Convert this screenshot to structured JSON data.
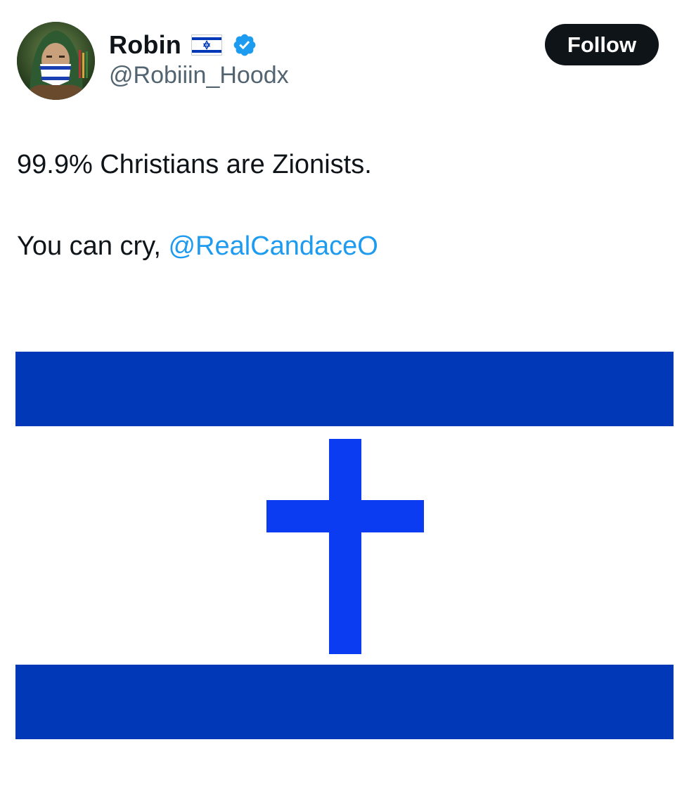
{
  "author": {
    "display_name": "Robin",
    "flag_emoji": "🇮🇱",
    "handle": "@Robiiin_Hoodx",
    "verified": true
  },
  "follow_button": {
    "label": "Follow"
  },
  "tweet": {
    "line1": "99.9% Christians are Zionists.",
    "line2_prefix": "You can cry, ",
    "mention": "@RealCandaceO"
  },
  "colors": {
    "text": "#0f1419",
    "secondary_text": "#536471",
    "link": "#1d9bf0",
    "verified_badge": "#1d9bf0",
    "follow_button_bg": "#0f1419",
    "flag_blue": "#0038b8",
    "cross_blue": "#0b3cf2"
  },
  "icons": {
    "verified": "verified-badge-icon",
    "flag": "israel-flag-icon"
  }
}
